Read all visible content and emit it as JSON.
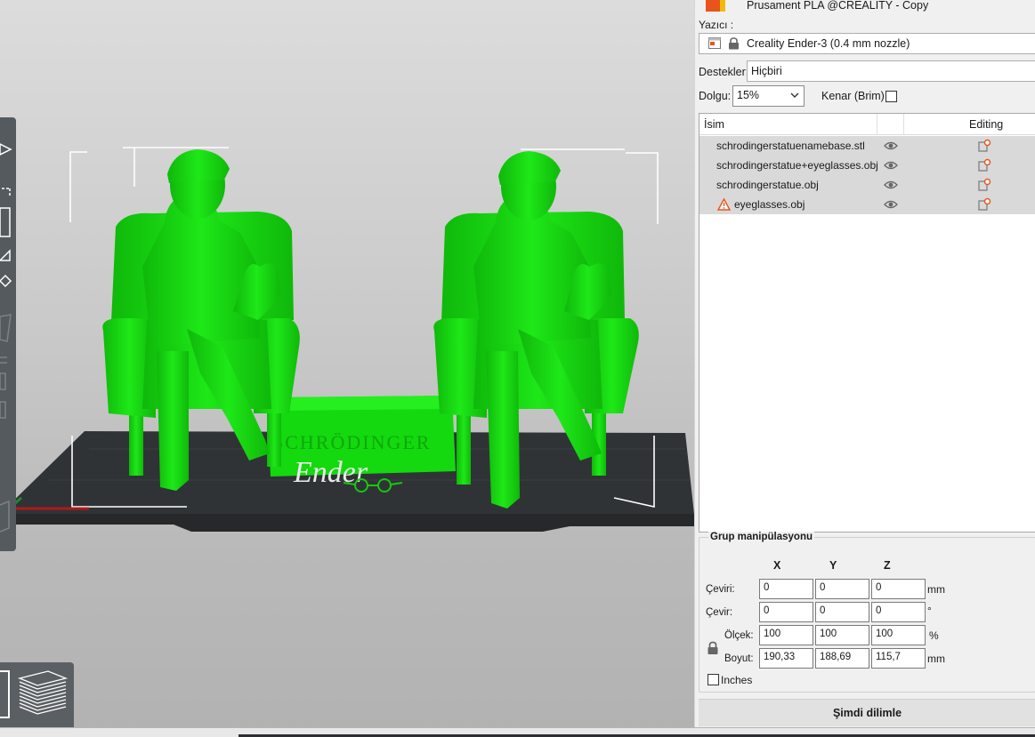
{
  "material": {
    "name": "Prusament PLA @CREALITY - Copy",
    "swatch_colors": [
      "#e8541b",
      "#f2b90d"
    ]
  },
  "printer": {
    "label": "Yazıcı :",
    "name": "Creality Ender-3 (0.4 mm nozzle)"
  },
  "supports": {
    "label": "Destekler:",
    "value": "Hiçbiri"
  },
  "infill": {
    "label": "Dolgu:",
    "value": "15%"
  },
  "brim": {
    "label": "Kenar (Brim):",
    "checked": false
  },
  "objects_table": {
    "headers": {
      "name": "İsim",
      "editing": "Editing"
    },
    "rows": [
      {
        "name": "schrodingerstatuenamebase.stl",
        "warning": false
      },
      {
        "name": "schrodingerstatue+eyeglasses.obj",
        "warning": false
      },
      {
        "name": "schrodingerstatue.obj",
        "warning": false
      },
      {
        "name": "eyeglasses.obj",
        "warning": true
      }
    ]
  },
  "group_manipulation": {
    "title": "Grup manipülasyonu",
    "axes": [
      "X",
      "Y",
      "Z"
    ],
    "rows": [
      {
        "label": "Çeviri:",
        "values": [
          "0",
          "0",
          "0"
        ],
        "unit": "mm"
      },
      {
        "label": "Çevir:",
        "values": [
          "0",
          "0",
          "0"
        ],
        "unit": "°"
      },
      {
        "label": "Ölçek:",
        "values": [
          "100",
          "100",
          "100"
        ],
        "unit": "%"
      },
      {
        "label": "Boyut:",
        "values": [
          "190,33",
          "188,69",
          "115,7"
        ],
        "unit": "mm"
      }
    ],
    "inches_label": "Inches"
  },
  "slice_button": "Şimdi dilimle",
  "viewport": {
    "model_color": "#13dd0d",
    "bed_text": "Ender",
    "base_text": "SCHRÖDINGER"
  }
}
